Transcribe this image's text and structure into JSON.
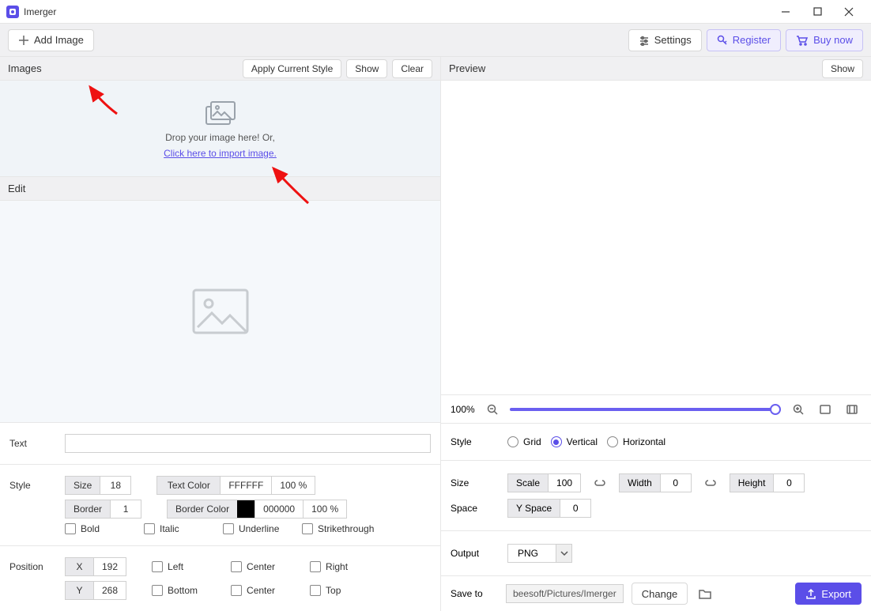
{
  "app": {
    "title": "Imerger"
  },
  "toolbar": {
    "add_image": "Add Image",
    "settings": "Settings",
    "register": "Register",
    "buy_now": "Buy now"
  },
  "images_panel": {
    "title": "Images",
    "apply_style": "Apply Current Style",
    "show": "Show",
    "clear": "Clear",
    "drop_text": "Drop your image here! Or,",
    "drop_link": "Click here to import image."
  },
  "edit_panel": {
    "title": "Edit"
  },
  "text_form": {
    "text_label": "Text",
    "text_value": "",
    "style_label": "Style",
    "size_label": "Size",
    "size_value": "18",
    "textcolor_label": "Text Color",
    "textcolor_value": "FFFFFF",
    "textcolor_opacity": "100 %",
    "border_label": "Border",
    "border_value": "1",
    "bordercolor_label": "Border Color",
    "bordercolor_value": "000000",
    "bordercolor_opacity": "100 %",
    "bold": "Bold",
    "italic": "Italic",
    "underline": "Underline",
    "strike": "Strikethrough",
    "position_label": "Position",
    "x_label": "X",
    "x_value": "192",
    "y_label": "Y",
    "y_value": "268",
    "left": "Left",
    "center": "Center",
    "right": "Right",
    "bottom": "Bottom",
    "top": "Top"
  },
  "preview_panel": {
    "title": "Preview",
    "show": "Show"
  },
  "zoom": {
    "percent": "100%"
  },
  "right_controls": {
    "style_label": "Style",
    "grid": "Grid",
    "vertical": "Vertical",
    "horizontal": "Horizontal",
    "size_label": "Size",
    "scale_label": "Scale",
    "scale_value": "100",
    "width_label": "Width",
    "width_value": "0",
    "height_label": "Height",
    "height_value": "0",
    "space_label": "Space",
    "yspace_label": "Y Space",
    "yspace_value": "0",
    "output_label": "Output",
    "output_value": "PNG",
    "saveto_label": "Save to",
    "saveto_path": "beesoft/Pictures/Imerger",
    "change": "Change",
    "export": "Export"
  }
}
